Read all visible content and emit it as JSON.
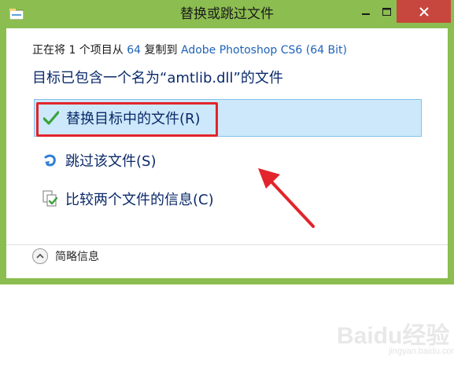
{
  "window": {
    "title": "替换或跳过文件",
    "controls": {
      "minimize": "minimize",
      "maximize": "maximize",
      "close": "close"
    }
  },
  "description": {
    "prefix": "正在将 1 个项目从 ",
    "source": "64",
    "middle": " 复制到 ",
    "destination": "Adobe Photoshop CS6 (64 Bit)"
  },
  "headline": "目标已包含一个名为“amtlib.dll”的文件",
  "options": [
    {
      "label": "替换目标中的文件(R)",
      "icon": "check-icon",
      "selected": true
    },
    {
      "label": "跳过该文件(S)",
      "icon": "skip-arrow-icon",
      "selected": false
    },
    {
      "label": "比较两个文件的信息(C)",
      "icon": "compare-files-icon",
      "selected": false
    }
  ],
  "footer": {
    "details_label": "简略信息",
    "icon": "chevron-up-icon"
  },
  "watermark": {
    "logo": "Baidu经验",
    "url": "jingyan.baidu.com"
  },
  "colors": {
    "frame": "#8cbd50",
    "close_button": "#c7463d",
    "selection_bg": "#cce8fa",
    "selection_border": "#82c2ec",
    "annotation_red": "#e2242b",
    "link": "#1e63b8"
  }
}
